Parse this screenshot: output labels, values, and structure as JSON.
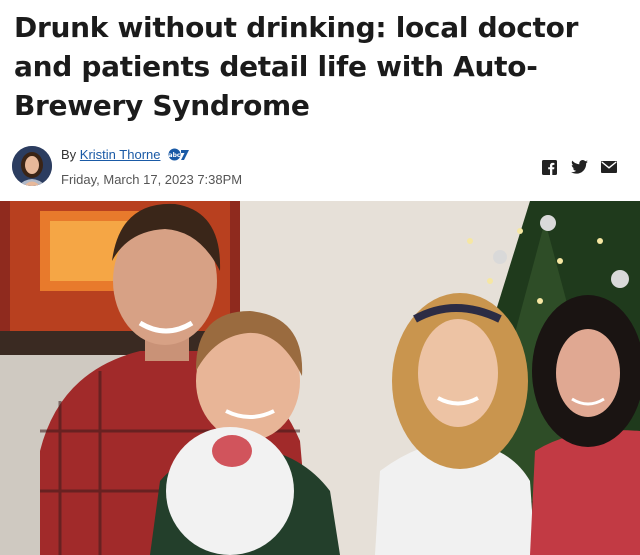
{
  "article": {
    "headline": "Drunk without drinking: local doctor and patients detail life with Auto-Brewery Syndrome",
    "by_prefix": "By",
    "author": "Kristin Thorne",
    "date": "Friday, March 17, 2023 7:38PM"
  },
  "share": {
    "icons": [
      "facebook-icon",
      "twitter-icon",
      "email-icon"
    ]
  },
  "colors": {
    "link": "#1a5aa6",
    "headline": "#1b1b1b",
    "icon": "#222222"
  }
}
